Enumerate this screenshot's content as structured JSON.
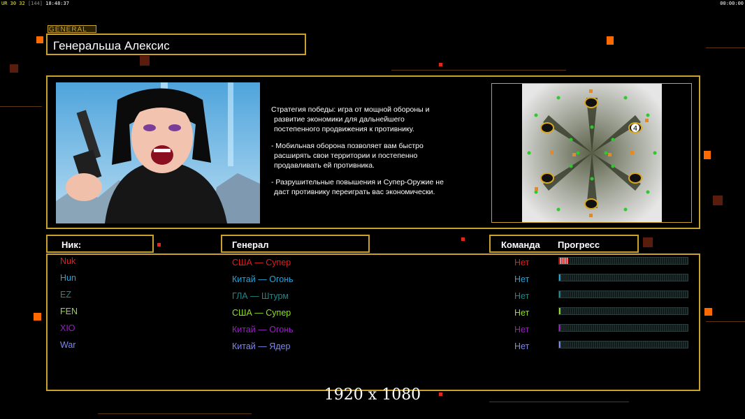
{
  "hud": {
    "stats_left": "UR 30 32",
    "stats_bracket": "[144]",
    "clock": "18:48:37",
    "timer": "00:00:00"
  },
  "header": {
    "tab_label": "GENERAL",
    "general_name": "Генеральша Алексис"
  },
  "portrait": {
    "icon": "general-portrait"
  },
  "description": [
    {
      "lines": [
        "Стратегия победы: игра от мощной обороны и",
        "развитие экономики для дальнейшего",
        "постепенного продвижения к противнику."
      ]
    },
    {
      "lines": [
        "- Мобильная оборона позволяет вам быстро",
        "расширять свои территории и постепенно",
        "продавливать ей противника."
      ]
    },
    {
      "lines": [
        "- Разрушительные повышения и Супер-Оружие не",
        "даст противнику переиграть вас экономически."
      ]
    }
  ],
  "map": {
    "icon": "minimap",
    "marker_number": "4"
  },
  "columns": {
    "nick": "Ник:",
    "general": "Генерал",
    "team": "Команда",
    "progress": "Прогресс"
  },
  "players": [
    {
      "nick": "Nuk",
      "general": "США — Супер",
      "team": "Нет",
      "color": "#e21e1e",
      "progress": 0.07
    },
    {
      "nick": "Hun",
      "general": "Китай — Огонь",
      "team": "Нет",
      "color": "#1ea6e0",
      "progress": 0.01
    },
    {
      "nick": "EZ",
      "general": "ГЛА — Штурм",
      "team": "Нет",
      "color": "#1a8a8a",
      "progress": 0.01
    },
    {
      "nick": "FEN",
      "general": "США — Супер",
      "team": "Нет",
      "color": "#8ee21e",
      "progress": 0.01
    },
    {
      "nick": "XIO",
      "general": "Китай — Огонь",
      "team": "Нет",
      "color": "#9a1ec8",
      "progress": 0.01
    },
    {
      "nick": "War",
      "general": "Китай — Ядер",
      "team": "Нет",
      "color": "#7e88f0",
      "progress": 0.01
    }
  ],
  "footer": {
    "resolution": "1920 x 1080"
  }
}
